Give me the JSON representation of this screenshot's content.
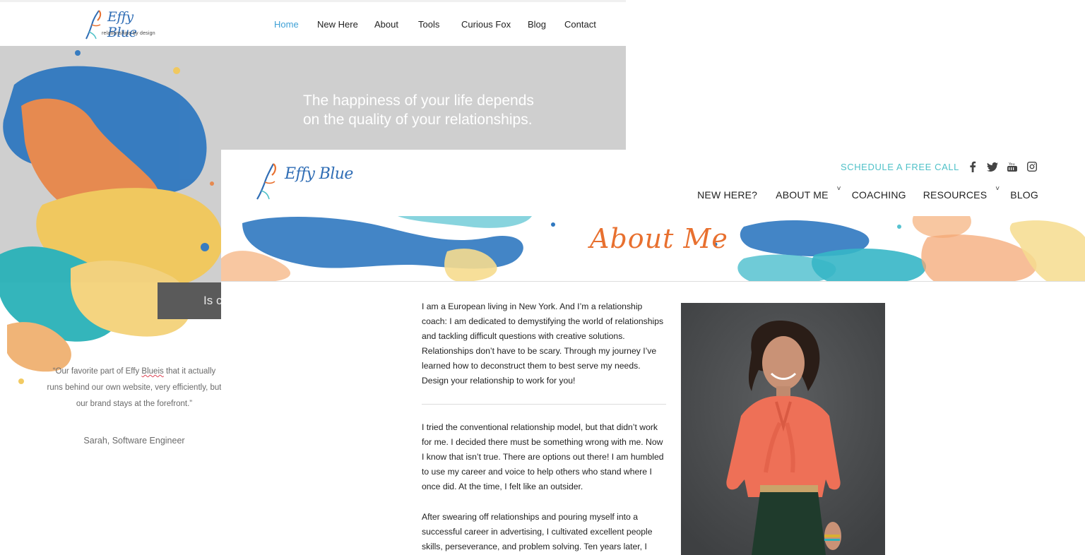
{
  "back_site": {
    "logo": {
      "word": "Effy Blue",
      "tagline": "relationships by design"
    },
    "nav": [
      {
        "label": "Home",
        "active": true
      },
      {
        "label": "New Here",
        "active": false
      },
      {
        "label": "About",
        "active": false
      },
      {
        "label": "Tools",
        "active": false
      },
      {
        "label": "Curious Fox",
        "active": false
      },
      {
        "label": "Blog",
        "active": false
      },
      {
        "label": "Contact",
        "active": false
      }
    ],
    "hero_quote_line1": "The happiness of your life depends",
    "hero_quote_line2": "on the quality of your relationships.",
    "bar_text": "Is c",
    "testimonial": {
      "before": "“Our favorite part of Effy ",
      "underlined": "Blueis",
      "after": " that it actually runs behind our own website, very efficiently, but our brand stays at the forefront.”",
      "author": "Sarah, Software Engineer"
    }
  },
  "front_site": {
    "logo": {
      "word": "Effy Blue"
    },
    "schedule_cta": "Schedule a free call",
    "social": [
      "facebook-icon",
      "twitter-icon",
      "youtube-icon",
      "instagram-icon"
    ],
    "nav": [
      {
        "label": "New Here?",
        "dropdown": false
      },
      {
        "label": "About Me",
        "dropdown": true
      },
      {
        "label": "Coaching",
        "dropdown": false
      },
      {
        "label": "Resources",
        "dropdown": true
      },
      {
        "label": "Blog",
        "dropdown": false
      }
    ],
    "banner_title": "About Me",
    "paragraphs": [
      "I am a European living in New York. And I’m a relationship coach: I am dedicated to demystifying the world of relationships and tackling difficult questions with creative solutions. Relationships don’t have to be scary. Through my journey I’ve learned how to deconstruct them to best serve my needs. Design your relationship to work for you!",
      "I tried the conventional relationship model, but that didn’t work for me. I decided there must be something wrong with me. Now I know that isn’t true. There are options out there! I am humbled to use my career and voice to help others who stand where I once did. At the time, I felt like an outsider.",
      "After swearing off relationships and pouring myself into a successful career in advertising, I cultivated excellent people skills, perseverance, and problem solving. Ten years later, I"
    ]
  },
  "colors": {
    "accent_blue": "#3ea0d6",
    "teal_cta": "#4fc1c8",
    "orange_title": "#e8702f",
    "hero_gray": "#cfcfcf"
  }
}
